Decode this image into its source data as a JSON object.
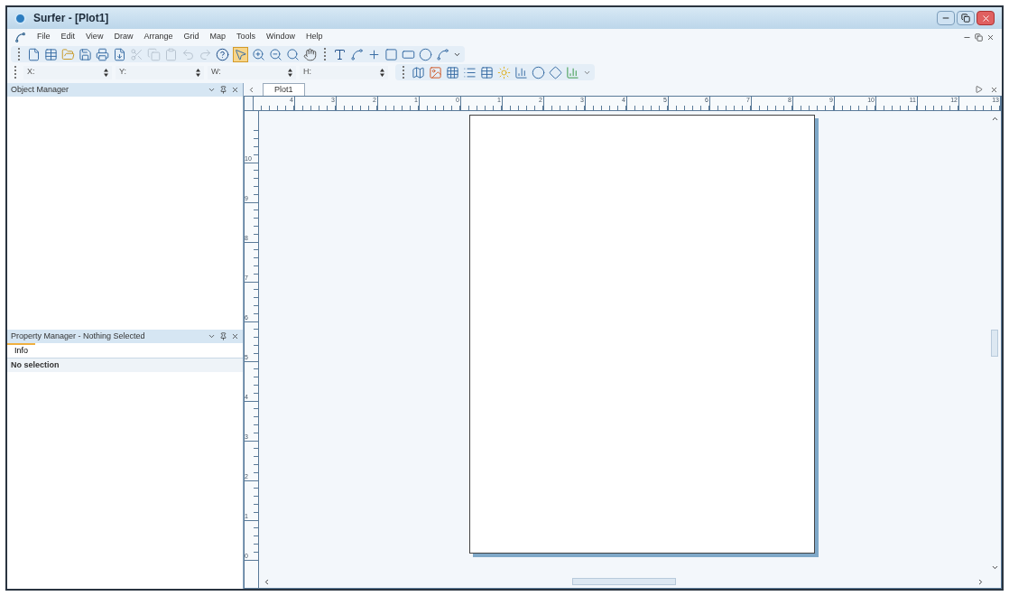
{
  "window": {
    "title": "Surfer - [Plot1]"
  },
  "menu": [
    "File",
    "Edit",
    "View",
    "Draw",
    "Arrange",
    "Grid",
    "Map",
    "Tools",
    "Window",
    "Help"
  ],
  "coordinate_fields": [
    {
      "label": "X:"
    },
    {
      "label": "Y:"
    },
    {
      "label": "W:"
    },
    {
      "label": "H:"
    }
  ],
  "object_manager": {
    "title": "Object Manager"
  },
  "property_manager": {
    "title": "Property Manager - Nothing Selected",
    "tabs": [
      {
        "label": "Info",
        "selected": true
      }
    ],
    "message": "No selection"
  },
  "document_tabs": [
    {
      "label": "Plot1",
      "selected": true
    }
  ],
  "ruler_horizontal": [
    "4",
    "3",
    "2",
    "1",
    "0",
    "1",
    "2",
    "3",
    "4",
    "5",
    "6",
    "7",
    "8",
    "9",
    "10",
    "11",
    "12",
    "13"
  ],
  "ruler_vertical": [
    "10",
    "9",
    "8",
    "7",
    "6",
    "5",
    "4",
    "3",
    "2",
    "1",
    "0"
  ]
}
